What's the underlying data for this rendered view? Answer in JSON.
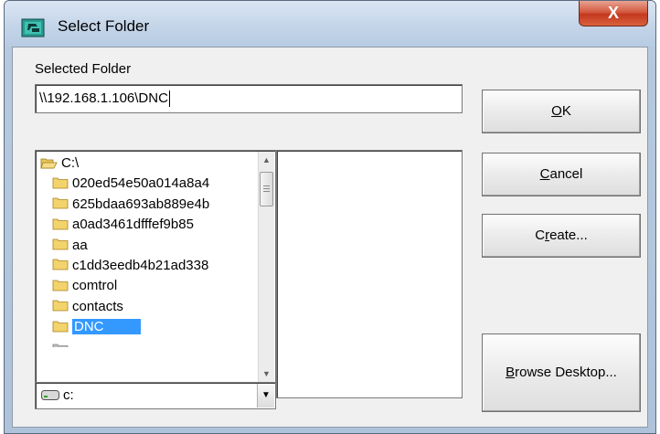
{
  "window": {
    "title": "Select Folder",
    "close_glyph": "X"
  },
  "selected_folder": {
    "label": "Selected Folder",
    "value": "\\\\192.168.1.106\\DNC"
  },
  "buttons": {
    "ok": {
      "mnemonic": "O",
      "rest": "K"
    },
    "cancel": {
      "mnemonic": "C",
      "rest": "ancel"
    },
    "create": {
      "pre": "C",
      "mnemonic": "r",
      "rest": "eate..."
    },
    "browse": {
      "mnemonic": "B",
      "rest": "rowse Desktop..."
    }
  },
  "folder_tree": {
    "root": "C:\\",
    "items": [
      "020ed54e50a014a8a4",
      "625bdaa693ab889e4b",
      "a0ad3461dfffef9b85",
      "aa",
      "c1dd3eedb4b21ad338",
      "comtrol",
      "contacts",
      "DNC"
    ],
    "selected_index": 7
  },
  "drive": {
    "value": "c:"
  },
  "colors": {
    "selection": "#3399ff",
    "folder": "#f3d36b"
  },
  "icons": {
    "title": "folder-select-icon",
    "drive": "hard-drive-icon",
    "folder": "folder-icon"
  }
}
